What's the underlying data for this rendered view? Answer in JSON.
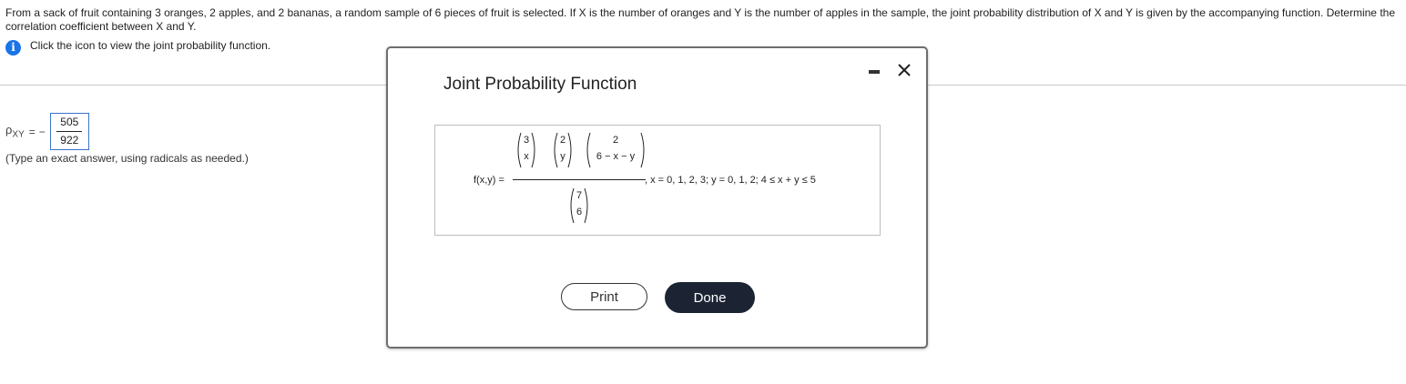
{
  "question": {
    "text": "From a sack of fruit containing 3 oranges, 2 apples, and 2 bananas, a random sample of 6 pieces of fruit is selected. If X is the number of oranges and Y is the number of apples in the sample, the joint probability distribution of X and Y is given by the accompanying function. Determine the correlation coefficient between X and Y."
  },
  "hint": {
    "icon": "info-icon",
    "text": "Click the icon to view the joint probability function."
  },
  "answer": {
    "symbol": "ρ",
    "subscript": "XY",
    "equals": "=",
    "sign": "−",
    "numerator": "505",
    "denominator": "922",
    "note": "(Type an exact answer, using radicals as needed.)"
  },
  "modal": {
    "title": "Joint Probability Function",
    "formula": {
      "lhs": "f(x,y) =",
      "binom1_top": "3",
      "binom1_bottom": "x",
      "binom2_top": "2",
      "binom2_bottom": "y",
      "binom3_top": "2",
      "binom3_bottom": "6 − x − y",
      "binom4_top": "7",
      "binom4_bottom": "6",
      "domain": ", x = 0, 1, 2, 3; y = 0, 1, 2; 4 ≤ x + y ≤ 5"
    },
    "print_label": "Print",
    "done_label": "Done"
  }
}
